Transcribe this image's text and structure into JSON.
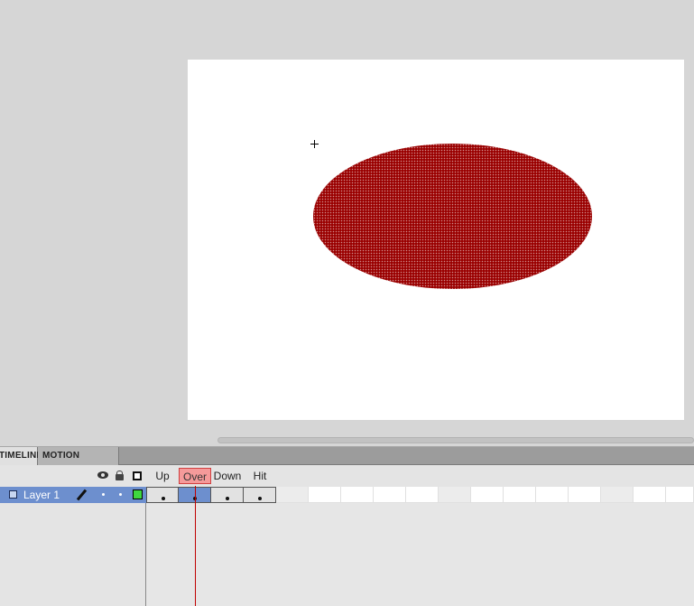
{
  "tabs": {
    "timeline_label": "TIMELINE",
    "motion_editor_label": "MOTION EDITOR"
  },
  "header_icons": {
    "eye": "eye-icon",
    "lock": "lock-icon",
    "outline": "outline-icon"
  },
  "frame_labels": [
    "Up",
    "Over",
    "Down",
    "Hit"
  ],
  "current_frame_label": "Over",
  "layers": [
    {
      "name": "Layer 1",
      "color": "#3fd83f",
      "keyframes": 4
    }
  ],
  "stage": {
    "background": "#ffffff",
    "shape_color": "#9a0000"
  },
  "colors": {
    "layer_selected": "#6d8fce",
    "playhead": "#c00000",
    "active_frame_label": "#f59a9a"
  }
}
